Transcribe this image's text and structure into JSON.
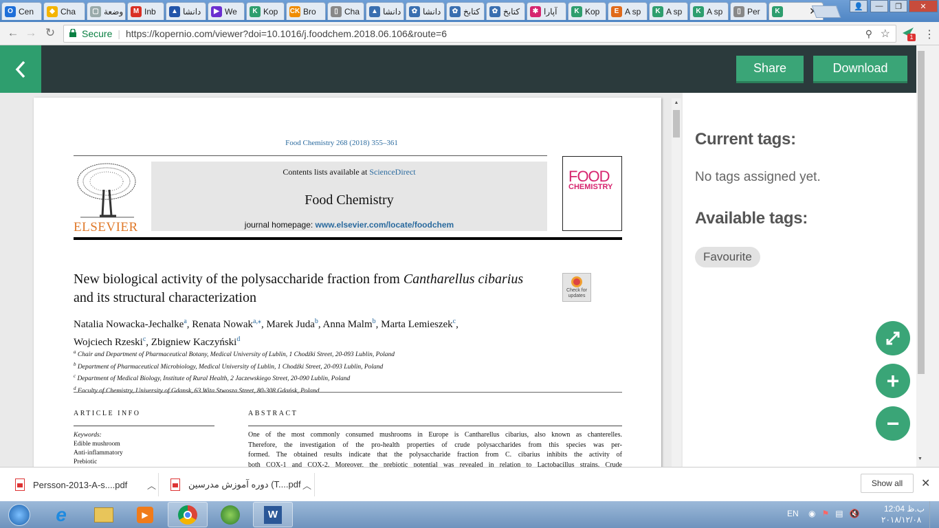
{
  "browser": {
    "tabs": [
      {
        "label": "Cen",
        "color": "#1e6fd9",
        "glyph": "O"
      },
      {
        "label": "Cha",
        "color": "#f4b400",
        "glyph": "◆"
      },
      {
        "label": "وضعة",
        "color": "#9aa",
        "glyph": "▢"
      },
      {
        "label": "Inb",
        "color": "#d93025",
        "glyph": "M"
      },
      {
        "label": "دانشا",
        "color": "#2255aa",
        "glyph": "▲"
      },
      {
        "label": "We",
        "color": "#6a2ed0",
        "glyph": "▶"
      },
      {
        "label": "Kop",
        "color": "#2e9e6e",
        "glyph": "K"
      },
      {
        "label": "Bro",
        "color": "#f08c00",
        "glyph": "CK"
      },
      {
        "label": "Cha",
        "color": "#888",
        "glyph": "▯"
      },
      {
        "label": "دانشا",
        "color": "#3a6fb0",
        "glyph": "▲"
      },
      {
        "label": "دانشا",
        "color": "#3a6fb0",
        "glyph": "✿"
      },
      {
        "label": "کتابخ",
        "color": "#3a6fb0",
        "glyph": "✿"
      },
      {
        "label": "کتابخ",
        "color": "#3a6fb0",
        "glyph": "✿"
      },
      {
        "label": "آپارا",
        "color": "#d6246e",
        "glyph": "✱"
      },
      {
        "label": "Kop",
        "color": "#2e9e6e",
        "glyph": "K"
      },
      {
        "label": "A sp",
        "color": "#e06a1a",
        "glyph": "E"
      },
      {
        "label": "A sp",
        "color": "#2e9e6e",
        "glyph": "K"
      },
      {
        "label": "A sp",
        "color": "#2e9e6e",
        "glyph": "K"
      },
      {
        "label": "Per",
        "color": "#888",
        "glyph": "▯"
      },
      {
        "label": "",
        "color": "#2e9e6e",
        "glyph": "K",
        "active": true
      }
    ],
    "close_glyph": "✕",
    "address": {
      "secure_label": "Secure",
      "url": "https://kopernio.com/viewer?doi=10.1016/j.foodchem.2018.06.106&route=6"
    },
    "extension_badge": "1"
  },
  "app": {
    "share_label": "Share",
    "download_label": "Download"
  },
  "paper": {
    "citation": "Food Chemistry 268 (2018) 355–361",
    "contents_prefix": "Contents lists available at ",
    "contents_link": "ScienceDirect",
    "journal_name": "Food Chemistry",
    "homepage_prefix": "journal homepage: ",
    "homepage_link": "www.elsevier.com/locate/foodchem",
    "publisher": "ELSEVIER",
    "cover_line1": "FOOD",
    "cover_line2": "CHEMISTRY",
    "check_updates": "Check for updates",
    "title_a": "New biological activity of the polysaccharide fraction from ",
    "title_b": "Cantharellus cibarius",
    "title_c": " and its structural characterization",
    "authors": [
      {
        "name": "Natalia Nowacka-Jechalke",
        "sup": "a"
      },
      {
        "name": "Renata Nowak",
        "sup": "a,⁎"
      },
      {
        "name": "Marek Juda",
        "sup": "b"
      },
      {
        "name": "Anna Malm",
        "sup": "b"
      },
      {
        "name": "Marta Lemieszek",
        "sup": "c"
      },
      {
        "name": "Wojciech Rzeski",
        "sup": "c"
      },
      {
        "name": "Zbigniew Kaczyński",
        "sup": "d"
      }
    ],
    "affiliations": [
      {
        "sup": "a",
        "text": "Chair and Department of Pharmaceutical Botany, Medical University of Lublin, 1 Chodźki Street, 20-093 Lublin, Poland"
      },
      {
        "sup": "b",
        "text": "Department of Pharmaceutical Microbiology, Medical University of Lublin, 1 Chodźki Street, 20-093 Lublin, Poland"
      },
      {
        "sup": "c",
        "text": "Department of Medical Biology, Institute of Rural Health, 2 Jaczewskiego Street, 20-090 Lublin, Poland"
      },
      {
        "sup": "d",
        "text": "Faculty of Chemistry, University of Gdansk, 63 Wita Stwosza Street, 80-308 Gdańsk, Poland"
      }
    ],
    "article_info_heading": "ARTICLE INFO",
    "abstract_heading": "ABSTRACT",
    "keywords_label": "Keywords:",
    "keywords": [
      "Edible mushroom",
      "Anti-inflammatory",
      "Prebiotic"
    ],
    "abstract_lines": [
      "One of the most commonly consumed mushrooms in Europe is Cantharellus cibarius, also known as chanterelles.",
      "Therefore, the investigation of the pro-health properties of crude polysaccharides from this species was per-",
      "formed. The obtained results indicate that the polysaccharide fraction from C. cibarius inhibits the activity of",
      "both COX-1 and COX-2. Moreover, the prebiotic potential was revealed in relation to Lactobacillus strains. Crude"
    ]
  },
  "sidebar": {
    "current_tags_heading": "Current tags:",
    "no_tags_text": "No tags assigned yet.",
    "available_tags_heading": "Available tags:",
    "tags": [
      "Favourite"
    ]
  },
  "downloads": {
    "items": [
      {
        "name": "Persson-2013-A-s....pdf"
      },
      {
        "name": "دوره آموزش مدرسین (T....pdf"
      }
    ],
    "show_all_label": "Show all"
  },
  "taskbar": {
    "language": "EN",
    "time": "12:04 ب.ظ",
    "date": "۲۰۱۸/۱۲/۰۸"
  },
  "colors": {
    "accent_green": "#3aa577",
    "appbar_dark": "#2b3a3c",
    "link_blue": "#2a6a9e",
    "elsevier_orange": "#e0792a"
  }
}
